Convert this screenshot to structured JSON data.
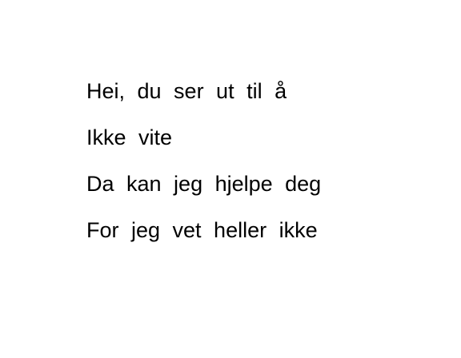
{
  "poem": {
    "lines": [
      "Hei, du ser ut til å",
      "Ikke vite",
      "Da kan jeg hjelpe deg",
      "For jeg vet heller ikke"
    ]
  },
  "colors": {
    "background": "#ffffff",
    "text": "#000000"
  }
}
